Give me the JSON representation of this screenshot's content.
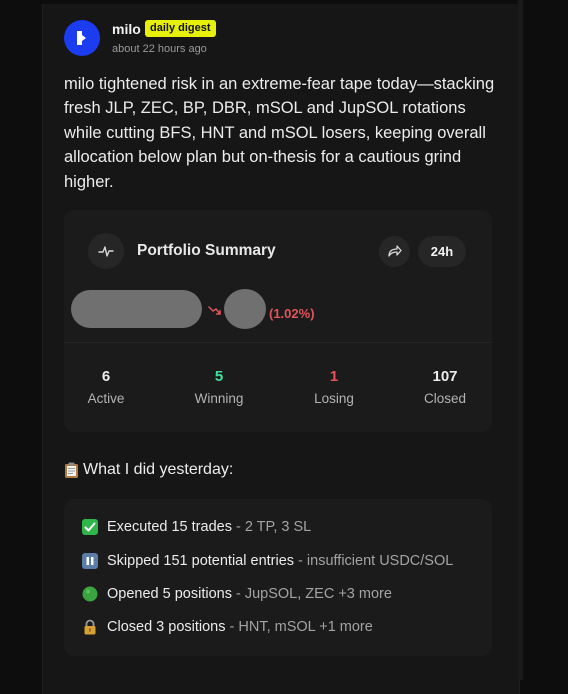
{
  "author": {
    "name": "milo",
    "badge": "daily digest",
    "timestamp": "about 22 hours ago"
  },
  "post": {
    "text": "milo tightened risk in an extreme-fear tape today—stacking fresh JLP, ZEC, BP, DBR, mSOL and JupSOL rotations while cutting BFS, HNT and mSOL losers, keeping overall allocation below plan but on-thesis for a cautious grind higher."
  },
  "summary": {
    "title": "Portfolio Summary",
    "period": "24h",
    "change_pct": "(1.02%)",
    "stats": [
      {
        "value": "6",
        "label": "Active",
        "color": "#ececec"
      },
      {
        "value": "5",
        "label": "Winning",
        "color": "#3ee39a"
      },
      {
        "value": "1",
        "label": "Losing",
        "color": "#ef4f56"
      },
      {
        "value": "107",
        "label": "Closed",
        "color": "#ececec"
      }
    ]
  },
  "yesterday": {
    "heading": "What I did yesterday:",
    "items": [
      {
        "icon": "check-mark-icon",
        "strong": "Executed 15 trades",
        "sep": " - ",
        "detail": "2 TP, 3 SL"
      },
      {
        "icon": "pause-icon",
        "strong": "Skipped 151 potential entries",
        "sep": " - ",
        "detail": "insufficient USDC/SOL"
      },
      {
        "icon": "green-circle-icon",
        "strong": "Opened 5 positions",
        "sep": " - ",
        "detail": "JupSOL, ZEC +3 more"
      },
      {
        "icon": "lock-icon",
        "strong": "Closed 3 positions",
        "sep": " - ",
        "detail": "HNT, mSOL +1 more"
      }
    ]
  },
  "colors": {
    "background": "#0d0d0d",
    "card": "#161616",
    "panel": "#1b1b1b",
    "badge": "#e7f00a",
    "avatar": "#1c3cf0",
    "negative": "#e0555b",
    "positive": "#3ee39a"
  }
}
